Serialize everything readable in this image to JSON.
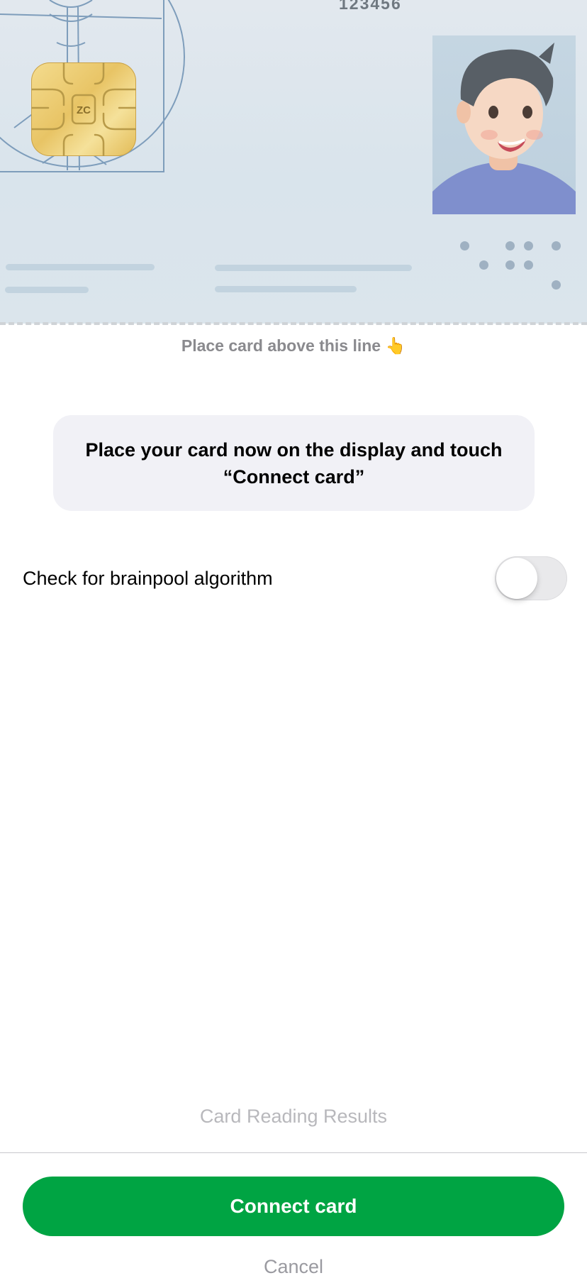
{
  "card": {
    "number": "123456",
    "chip_mark": "ZC"
  },
  "hint": {
    "text": "Place card above this line 👆"
  },
  "instruction": {
    "text": "Place your card now on the display and touch\n“Connect card”"
  },
  "brainpool": {
    "label": "Check for brainpool algorithm",
    "enabled": false
  },
  "results_link": "Card Reading Results",
  "actions": {
    "connect_label": "Connect card",
    "cancel_label": "Cancel"
  },
  "colors": {
    "accent": "#00a443",
    "card_background": "#dbe5ec"
  }
}
